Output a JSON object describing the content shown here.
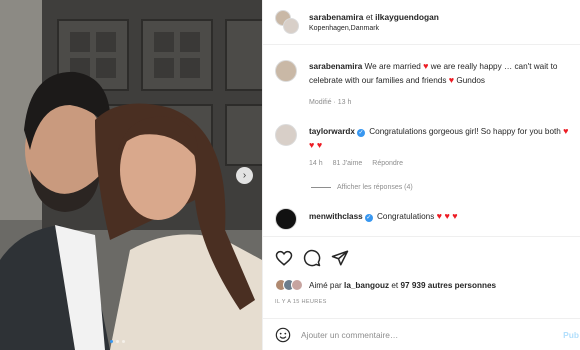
{
  "post": {
    "header": {
      "users": "sarabenamira",
      "et": "et",
      "users2": "ilkayguendogan",
      "location": "Kopenhagen,Danmark"
    },
    "caption": {
      "user": "sarabenamira",
      "text1": " We are married ",
      "text2": " we are really happy … can't wait to celebrate with our families and friends ",
      "text3": " Gundos",
      "meta": "Modifié · 13 h"
    },
    "comments": [
      {
        "user": "taylorwardx",
        "text": " Congratulations gorgeous girl! So happy for you both ",
        "hearts": "♥ ♥ ♥",
        "time": "14 h",
        "likes": "81 J'aime",
        "reply": "Répondre",
        "view_replies": "Afficher les réponses (4)"
      },
      {
        "user": "menwithclass",
        "text": " Congratulations ",
        "hearts": "♥ ♥ ♥"
      }
    ],
    "actions": {
      "icons": [
        "heart-icon",
        "comment-icon",
        "share-icon"
      ],
      "liked_by_prefix": "Aimé par ",
      "liked_by_user": "la_bangouz",
      "liked_by_mid": " et ",
      "liked_by_count": "97 939 autres personnes",
      "timestamp": "IL Y A 15 HEURES"
    },
    "add_comment": {
      "placeholder": "Ajouter un commentaire…",
      "publish": "Pub"
    },
    "heart_glyph": "♥",
    "carousel_next": "›",
    "verified_glyph": "✓"
  },
  "colors": {
    "accent": "#3897f0",
    "heart": "#ed1c24",
    "muted": "#8e8e8e"
  }
}
